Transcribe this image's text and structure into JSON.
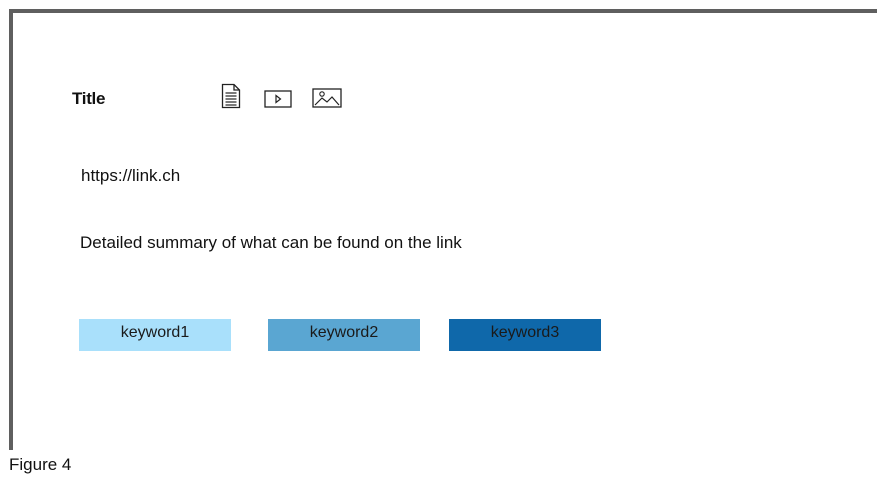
{
  "card": {
    "title": "Title",
    "icons": [
      "document-icon",
      "video-icon",
      "image-icon"
    ],
    "link": "https://link.ch",
    "summary": "Detailed summary of what can be found on the link",
    "keywords": [
      {
        "label": "keyword1",
        "color": "#a9e0fb"
      },
      {
        "label": "keyword2",
        "color": "#5aa6d2"
      },
      {
        "label": "keyword3",
        "color": "#0f68aa"
      }
    ]
  },
  "caption": "Figure 4",
  "colors": {
    "frame": "#5f5f5f",
    "icon_stroke": "#222222"
  }
}
